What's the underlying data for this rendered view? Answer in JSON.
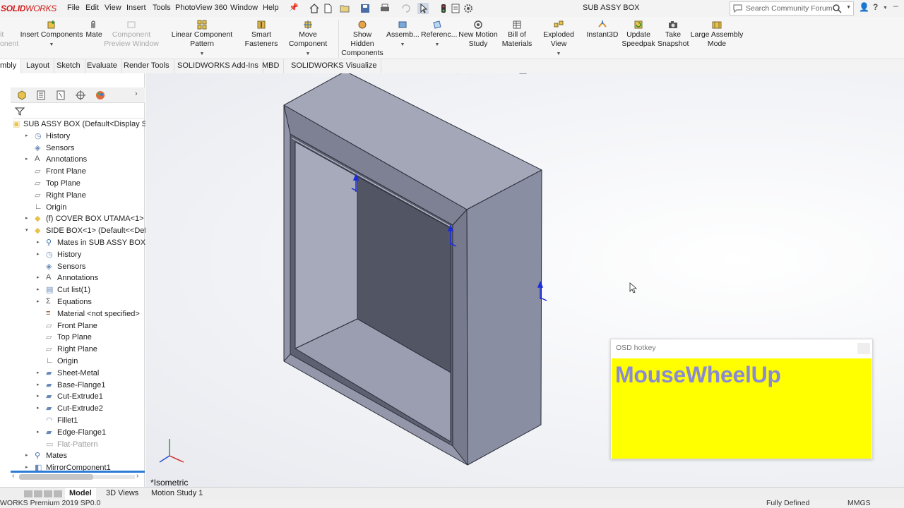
{
  "app": {
    "logo_bold": "SOLID",
    "logo_thin": "WORKS",
    "document_title": "SUB ASSY BOX"
  },
  "menu": [
    "File",
    "Edit",
    "View",
    "Insert",
    "Tools",
    "PhotoView 360",
    "Window",
    "Help"
  ],
  "search": {
    "placeholder": "Search Community Forum"
  },
  "commands": {
    "partial_left": [
      "it",
      "onent"
    ],
    "insert_components": "Insert Components",
    "mate": "Mate",
    "component_preview": [
      "Component",
      "Preview Window"
    ],
    "linear_pattern": "Linear Component Pattern",
    "smart_fasteners": [
      "Smart",
      "Fasteners"
    ],
    "move_component": "Move Component",
    "show_hidden": [
      "Show Hidden",
      "Components"
    ],
    "assembly_features": "Assemb...",
    "reference_geometry": "Referenc...",
    "new_motion_study": [
      "New Motion",
      "Study"
    ],
    "bill_of_materials": [
      "Bill of",
      "Materials"
    ],
    "exploded_view": "Exploded View",
    "instant3d": "Instant3D",
    "update_speedpak": [
      "Update",
      "Speedpak"
    ],
    "take_snapshot": [
      "Take",
      "Snapshot"
    ],
    "large_assembly": [
      "Large Assembly",
      "Mode"
    ]
  },
  "ribbon_tabs": [
    "mbly",
    "Layout",
    "Sketch",
    "Evaluate",
    "Render Tools",
    "SOLIDWORKS Add-Ins",
    "MBD",
    "SOLIDWORKS Visualize"
  ],
  "tree": [
    {
      "label": "SUB ASSY BOX  (Default<Display Sta",
      "indent": 0,
      "icon": "assembly-icon",
      "arrow": ""
    },
    {
      "label": "History",
      "indent": 1,
      "icon": "history-icon",
      "arrow": "▸"
    },
    {
      "label": "Sensors",
      "indent": 1,
      "icon": "sensors-icon",
      "arrow": ""
    },
    {
      "label": "Annotations",
      "indent": 1,
      "icon": "annotations-icon",
      "arrow": "▸"
    },
    {
      "label": "Front Plane",
      "indent": 1,
      "icon": "plane-icon",
      "arrow": ""
    },
    {
      "label": "Top Plane",
      "indent": 1,
      "icon": "plane-icon",
      "arrow": ""
    },
    {
      "label": "Right Plane",
      "indent": 1,
      "icon": "plane-icon",
      "arrow": ""
    },
    {
      "label": "Origin",
      "indent": 1,
      "icon": "origin-icon",
      "arrow": ""
    },
    {
      "label": "(f) COVER BOX UTAMA<1> (Defa",
      "indent": 1,
      "icon": "part-icon",
      "arrow": "▸"
    },
    {
      "label": "SIDE BOX<1> (Default<<Default",
      "indent": 1,
      "icon": "part-icon",
      "arrow": "▾"
    },
    {
      "label": "Mates in SUB ASSY BOX",
      "indent": 2,
      "icon": "mates-icon",
      "arrow": "▸"
    },
    {
      "label": "History",
      "indent": 2,
      "icon": "history-icon",
      "arrow": "▸"
    },
    {
      "label": "Sensors",
      "indent": 2,
      "icon": "sensors-icon",
      "arrow": ""
    },
    {
      "label": "Annotations",
      "indent": 2,
      "icon": "annotations-icon",
      "arrow": "▸"
    },
    {
      "label": "Cut list(1)",
      "indent": 2,
      "icon": "cut-list-icon",
      "arrow": "▸"
    },
    {
      "label": "Equations",
      "indent": 2,
      "icon": "equations-icon",
      "arrow": "▸"
    },
    {
      "label": "Material <not specified>",
      "indent": 2,
      "icon": "material-icon",
      "arrow": ""
    },
    {
      "label": "Front Plane",
      "indent": 2,
      "icon": "plane-icon",
      "arrow": ""
    },
    {
      "label": "Top Plane",
      "indent": 2,
      "icon": "plane-icon",
      "arrow": ""
    },
    {
      "label": "Right Plane",
      "indent": 2,
      "icon": "plane-icon",
      "arrow": ""
    },
    {
      "label": "Origin",
      "indent": 2,
      "icon": "origin-icon",
      "arrow": ""
    },
    {
      "label": "Sheet-Metal",
      "indent": 2,
      "icon": "sheet-metal-icon",
      "arrow": "▸"
    },
    {
      "label": "Base-Flange1",
      "indent": 2,
      "icon": "feature-icon",
      "arrow": "▸"
    },
    {
      "label": "Cut-Extrude1",
      "indent": 2,
      "icon": "feature-icon",
      "arrow": "▸"
    },
    {
      "label": "Cut-Extrude2",
      "indent": 2,
      "icon": "feature-icon",
      "arrow": "▸"
    },
    {
      "label": "Fillet1",
      "indent": 2,
      "icon": "fillet-icon",
      "arrow": ""
    },
    {
      "label": "Edge-Flange1",
      "indent": 2,
      "icon": "feature-icon",
      "arrow": "▸"
    },
    {
      "label": "Flat-Pattern",
      "indent": 2,
      "icon": "flat-pattern-icon",
      "arrow": "",
      "muted": true
    },
    {
      "label": "Mates",
      "indent": 1,
      "icon": "mates-icon",
      "arrow": "▸"
    },
    {
      "label": "MirrorComponent1",
      "indent": 1,
      "icon": "mirror-icon",
      "arrow": "▸"
    }
  ],
  "viewport": {
    "view_label": "*Isometric"
  },
  "osd": {
    "title": "OSD hotkey",
    "text": "MouseWheelUp"
  },
  "bottom_tabs": [
    "Model",
    "3D Views",
    "Motion Study 1"
  ],
  "status": {
    "left": "WORKS Premium 2019 SP0.0",
    "state": "Fully Defined",
    "units": "MMGS"
  }
}
